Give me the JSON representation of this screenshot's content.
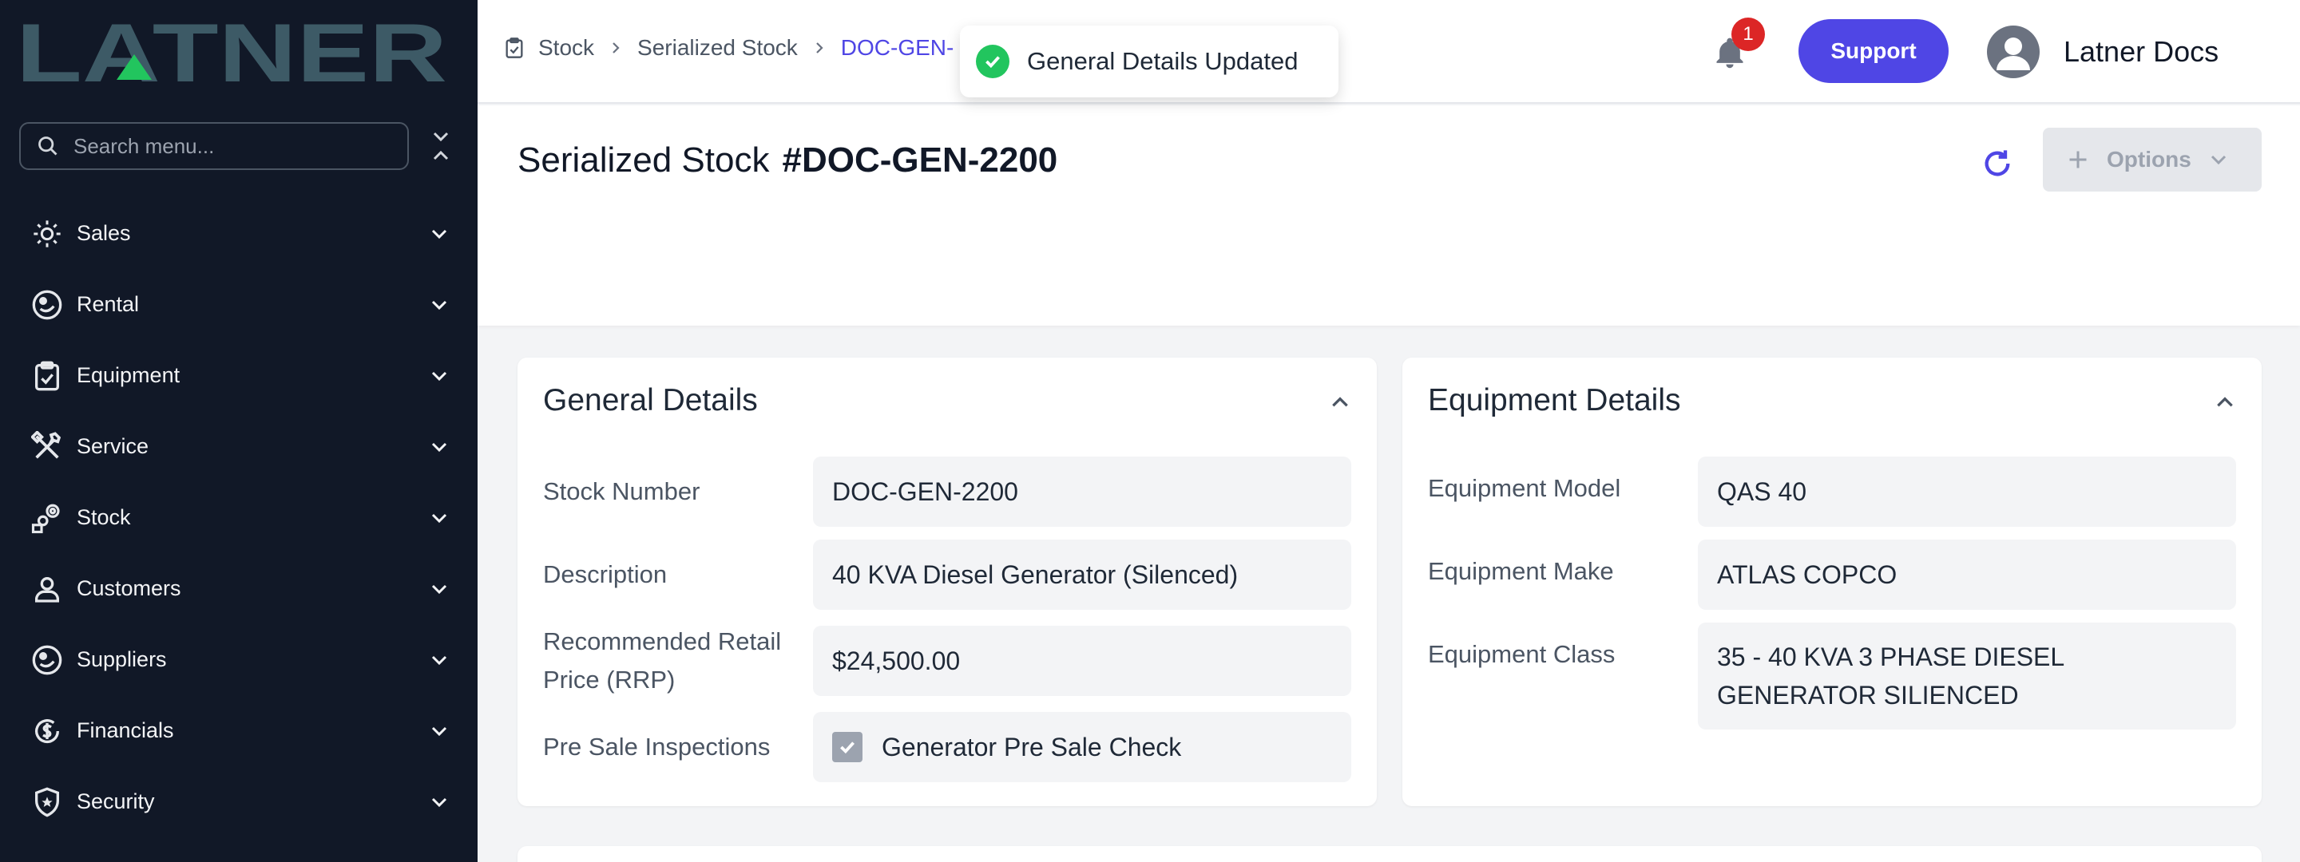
{
  "app": {
    "logo_text": "LATNER"
  },
  "sidebar": {
    "search_placeholder": "Search menu...",
    "items": [
      {
        "label": "Sales",
        "icon": "sales-icon"
      },
      {
        "label": "Rental",
        "icon": "rental-icon"
      },
      {
        "label": "Equipment",
        "icon": "clipboard-icon"
      },
      {
        "label": "Service",
        "icon": "tools-icon"
      },
      {
        "label": "Stock",
        "icon": "stock-icon"
      },
      {
        "label": "Customers",
        "icon": "user-icon"
      },
      {
        "label": "Suppliers",
        "icon": "suppliers-icon"
      },
      {
        "label": "Financials",
        "icon": "dollar-icon"
      },
      {
        "label": "Security",
        "icon": "shield-icon"
      }
    ]
  },
  "header": {
    "breadcrumb": [
      "Stock",
      "Serialized Stock",
      "DOC-GEN-"
    ],
    "notification_count": "1",
    "support_label": "Support",
    "user_name": "Latner Docs"
  },
  "toast": {
    "message": "General Details Updated",
    "status_color": "#22c55e"
  },
  "page": {
    "title": "Serialized Stock",
    "record_id": "#DOC-GEN-2200",
    "options_label": "Options"
  },
  "general_details": {
    "title": "General Details",
    "stock_number_label": "Stock Number",
    "stock_number": "DOC-GEN-2200",
    "description_label": "Description",
    "description": "40 KVA Diesel Generator (Silenced)",
    "rrp_label_line1": "Recommended Retail",
    "rrp_label_line2": "Price (RRP)",
    "rrp": "$24,500.00",
    "inspections_label": "Pre Sale Inspections",
    "inspection_item": "Generator Pre Sale Check",
    "inspection_checked": true
  },
  "equipment_details": {
    "title": "Equipment Details",
    "model_label": "Equipment Model",
    "model": "QAS 40",
    "make_label": "Equipment Make",
    "make": "ATLAS COPCO",
    "class_label": "Equipment Class",
    "class_line1": "35 - 40 KVA 3 PHASE DIESEL",
    "class_line2": "GENERATOR SILIENCED"
  },
  "colors": {
    "accent": "#4f46e5",
    "sidebar_bg": "#111827",
    "logo": "#3d5a66",
    "logo_triangle": "#22c55e"
  }
}
